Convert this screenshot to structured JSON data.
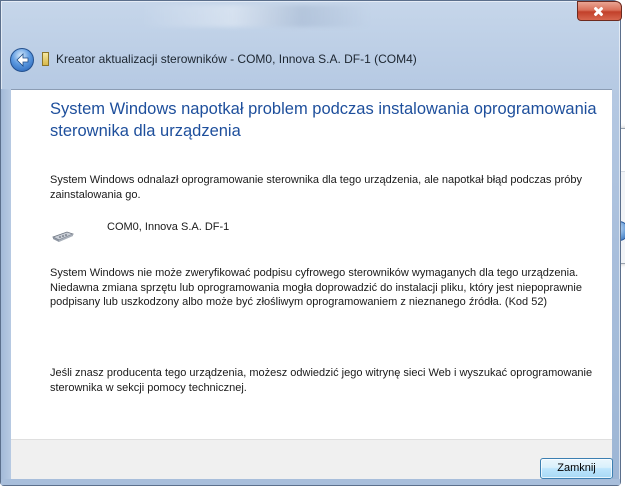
{
  "dialog": {
    "title": "Kreator aktualizacji sterowników - COM0, Innova S.A. DF-1 (COM4)",
    "heading": "System Windows napotkał problem podczas instalowania oprogramowania sterownika dla urządzenia",
    "intro": "System Windows odnalazł oprogramowanie sterownika dla tego urządzenia, ale napotkał błąd podczas próby zainstalowania go.",
    "device_name": "COM0, Innova S.A. DF-1",
    "error_text": "System Windows nie może zweryfikować podpisu cyfrowego sterowników wymaganych dla tego urządzenia. Niedawna zmiana sprzętu lub oprogramowania mogła doprowadzić do instalacji pliku, który jest niepoprawnie podpisany lub uszkodzony albo może być złośliwym oprogramowaniem z nieznanego źródła. (Kod 52)",
    "help_text": "Jeśli znasz producenta tego urządzenia, możesz odwiedzić jego witrynę sieci Web i wyszukać oprogramowanie sterownika w sekcji pomocy technicznej.",
    "close_button_label": "Zamknij"
  },
  "icons": {
    "back": "back-arrow-icon",
    "close": "close-icon",
    "app": "wizard-icon",
    "device": "serial-port-icon"
  },
  "colors": {
    "heading": "#1e4f9c",
    "close_button": "#c2402a",
    "frame": "#b4c8e2"
  }
}
